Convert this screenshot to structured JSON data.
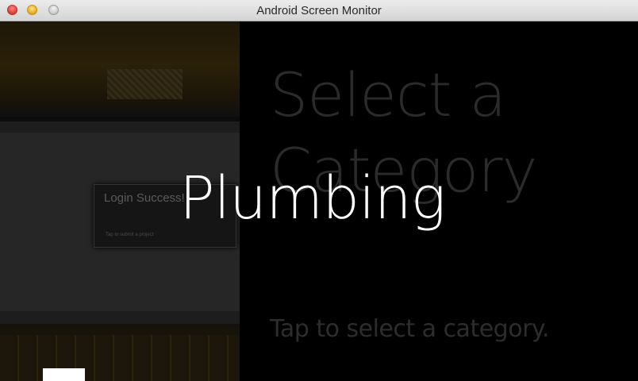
{
  "window": {
    "title": "Android Screen Monitor"
  },
  "photo": {
    "login_title": "Login Success!",
    "login_subtitle": "Tap to submit a project"
  },
  "screen": {
    "background_title": "Select a Category",
    "background_subtitle": "Tap to select a category.",
    "selected_category": "Plumbing"
  },
  "colors": {
    "foreground_text": "#ffffff",
    "dim_text": "#2b2b2b",
    "background": "#000000"
  }
}
